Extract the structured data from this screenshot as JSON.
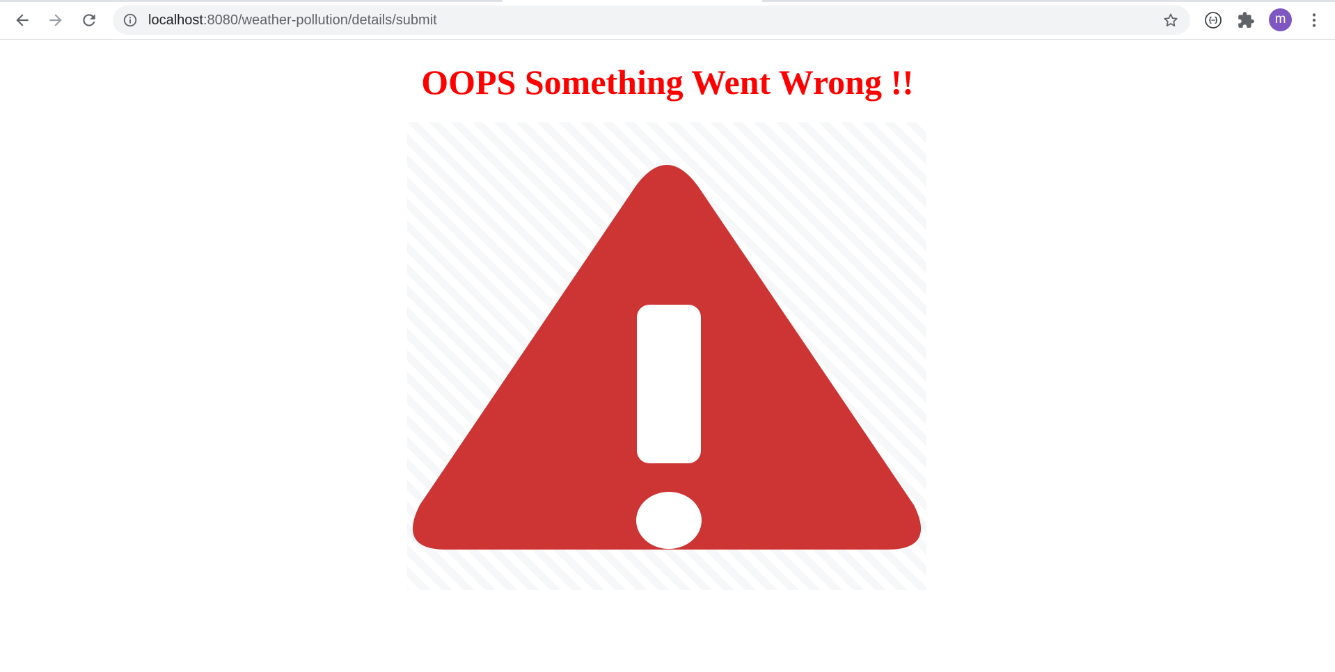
{
  "browser": {
    "url_host": "localhost",
    "url_path": ":8080/weather-pollution/details/submit",
    "profile_initial": "m",
    "icons": {
      "back": "arrow-left-icon",
      "forward": "arrow-right-icon",
      "reload": "reload-icon",
      "site_info": "info-icon",
      "bookmark": "star-icon",
      "extension_1": "code-braces-icon",
      "extension_2": "puzzle-icon",
      "menu": "kebab-menu-icon"
    },
    "colors": {
      "avatar": "#7e57c2",
      "omnibox_bg": "#f1f3f4"
    }
  },
  "page": {
    "heading": "OOPS Something Went Wrong !!",
    "heading_color": "#ff0000",
    "image": {
      "icon": "warning-triangle-icon",
      "triangle_color": "#cd3434"
    }
  }
}
